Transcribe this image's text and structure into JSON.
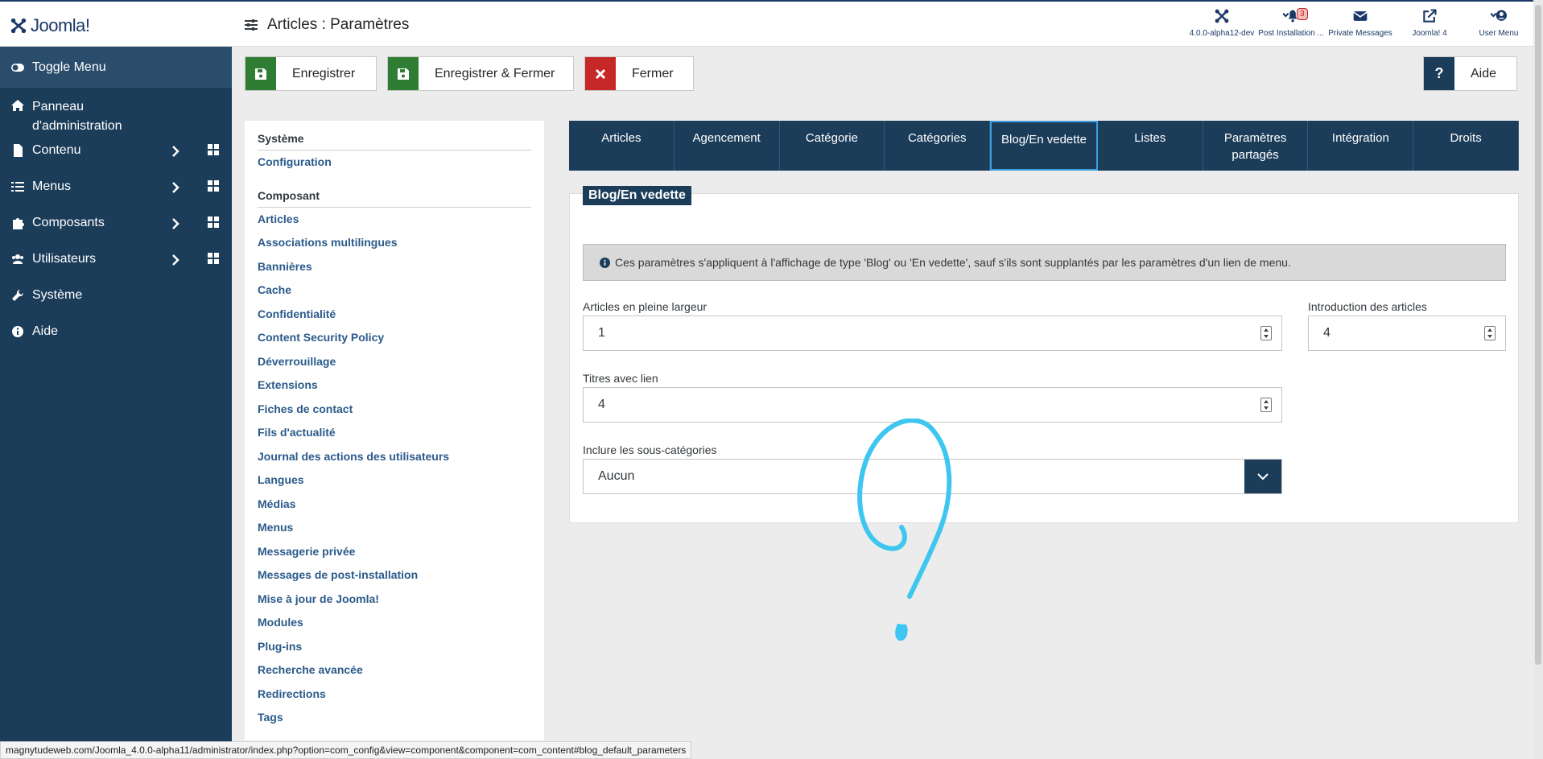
{
  "app": {
    "name": "Joomla!",
    "title": "Articles : Paramètres"
  },
  "header_items": [
    {
      "label": "4.0.0-alpha12-dev",
      "icon": "joomla-icon"
    },
    {
      "label": "Post Installation ...",
      "icon": "bell-icon",
      "badge": "3"
    },
    {
      "label": "Private Messages",
      "icon": "envelope-icon"
    },
    {
      "label": "Joomla! 4",
      "icon": "external-link-icon"
    },
    {
      "label": "User Menu",
      "icon": "user-icon"
    }
  ],
  "sidebar": {
    "toggle": "Toggle Menu",
    "items": [
      {
        "label": "Panneau d'administration",
        "icon": "home-icon"
      },
      {
        "label": "Contenu",
        "icon": "file-icon"
      },
      {
        "label": "Menus",
        "icon": "list-icon"
      },
      {
        "label": "Composants",
        "icon": "puzzle-icon"
      },
      {
        "label": "Utilisateurs",
        "icon": "users-icon"
      },
      {
        "label": "Système",
        "icon": "wrench-icon"
      },
      {
        "label": "Aide",
        "icon": "info-icon"
      }
    ]
  },
  "toolbar": {
    "save": "Enregistrer",
    "save_close": "Enregistrer & Fermer",
    "close": "Fermer",
    "help": "Aide"
  },
  "config_nav": {
    "system_heading": "Système",
    "system_items": [
      "Configuration"
    ],
    "component_heading": "Composant",
    "component_items": [
      "Articles",
      "Associations multilingues",
      "Bannières",
      "Cache",
      "Confidentialité",
      "Content Security Policy",
      "Déverrouillage",
      "Extensions",
      "Fiches de contact",
      "Fils d'actualité",
      "Journal des actions des utilisateurs",
      "Langues",
      "Médias",
      "Menus",
      "Messagerie privée",
      "Messages de post-installation",
      "Mise à jour de Joomla!",
      "Modules",
      "Plug-ins",
      "Recherche avancée",
      "Redirections",
      "Tags"
    ]
  },
  "tabs": [
    "Articles",
    "Agencement",
    "Catégorie",
    "Catégories",
    "Blog/En vedette",
    "Listes",
    "Paramètres partagés",
    "Intégration",
    "Droits"
  ],
  "active_tab": "Blog/En vedette",
  "panel": {
    "legend": "Blog/En vedette",
    "alert": "Ces paramètres s'appliquent à l'affichage de type 'Blog' ou 'En vedette', sauf s'ils sont supplantés par les paramètres d'un lien de menu.",
    "fields": {
      "full_width_label": "Articles en pleine largeur",
      "full_width_value": "1",
      "intro_label": "Introduction des articles",
      "intro_value": "4",
      "links_label": "Titres avec lien",
      "links_value": "4",
      "subcat_label": "Inclure les sous-catégories",
      "subcat_value": "Aucun"
    }
  },
  "status_url": "magnytudeweb.com/Joomla_4.0.0-alpha11/administrator/index.php?option=com_config&view=component&component=com_content#blog_default_parameters",
  "colors": {
    "navy": "#1c3d5a",
    "green": "#2f7d32",
    "red": "#c62828",
    "accent": "#3ec6f0"
  }
}
